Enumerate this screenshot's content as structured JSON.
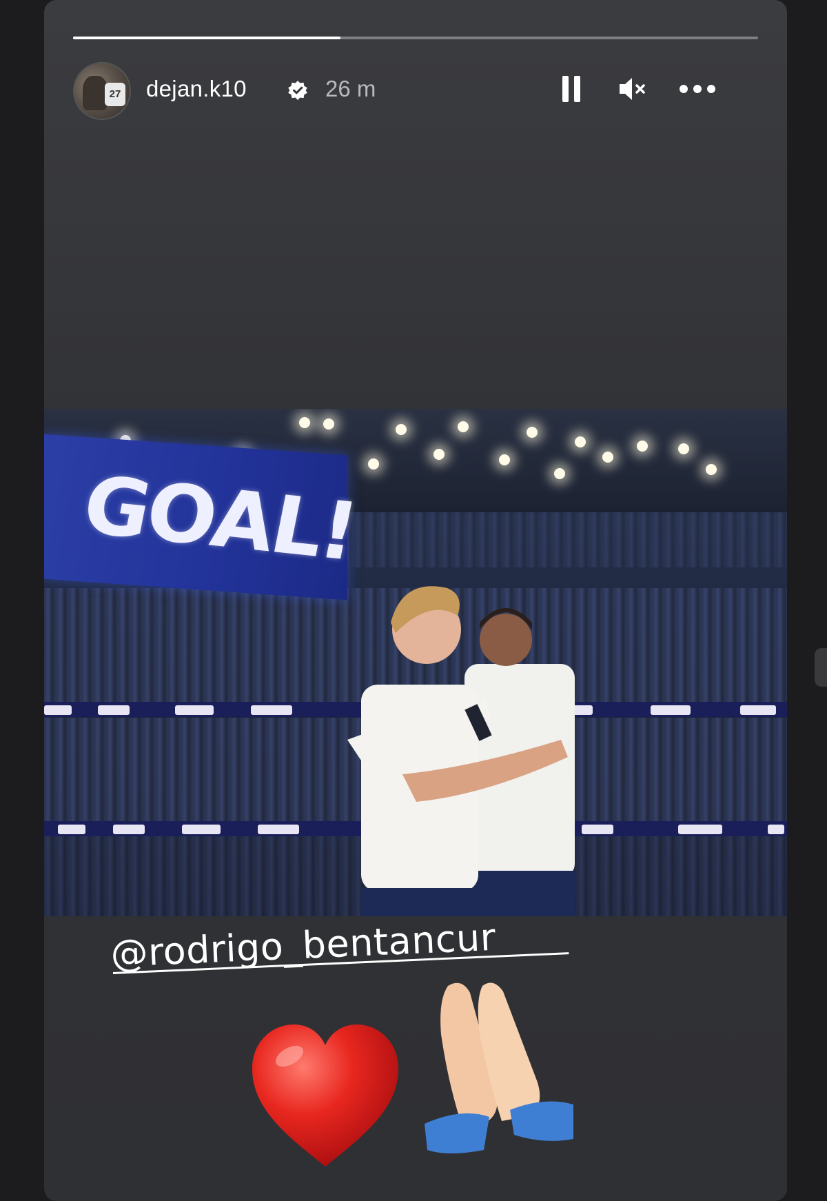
{
  "story": {
    "progress_fraction": 0.39,
    "user": {
      "username": "dejan.k10",
      "verified": true,
      "time_ago": "26 m",
      "avatar_jersey_number": "27"
    },
    "controls": {
      "pause": "pause-icon",
      "mute": "speaker-muted-icon",
      "more": "more-horizontal-icon"
    },
    "image": {
      "screen_text": "GOAL!"
    },
    "caption": {
      "mention": "@rodrigo_bentancur",
      "emojis": [
        "red-heart",
        "folded-hands"
      ]
    }
  },
  "colors": {
    "background": "#1c1c1e",
    "story_bg": "#333438",
    "text": "#ffffff",
    "muted_text": "#b8b9bd",
    "goal_screen": "#2a3ca4"
  }
}
